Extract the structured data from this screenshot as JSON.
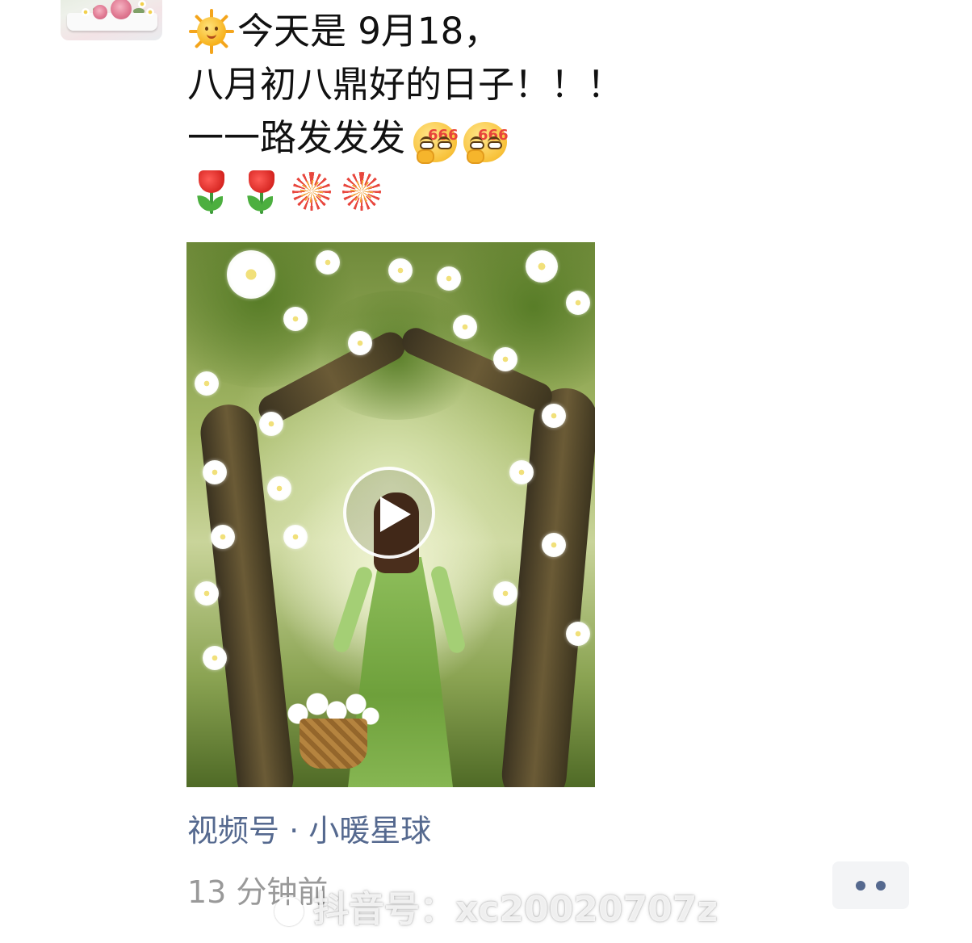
{
  "post": {
    "line1": "今天是 9月18，",
    "line2": "八月初八鼎好的日子！！！",
    "line3": "一一路发发发",
    "emoji_line1_start": "sun-icon",
    "emoji_line3_end": [
      "666-face-icon",
      "666-face-icon"
    ],
    "emoji_line4": [
      "tulip-icon",
      "tulip-icon",
      "fireworks-icon",
      "fireworks-icon"
    ],
    "emoji_666_text": "666"
  },
  "video": {
    "play_icon": "play-icon"
  },
  "channel": {
    "label": "视频号 · 小暖星球",
    "color": "#55698f"
  },
  "meta": {
    "timestamp": "13 分钟前"
  },
  "actions": {
    "more_icon": "more-dots-icon"
  },
  "watermark": {
    "text": "抖音号：xc20020707z"
  }
}
